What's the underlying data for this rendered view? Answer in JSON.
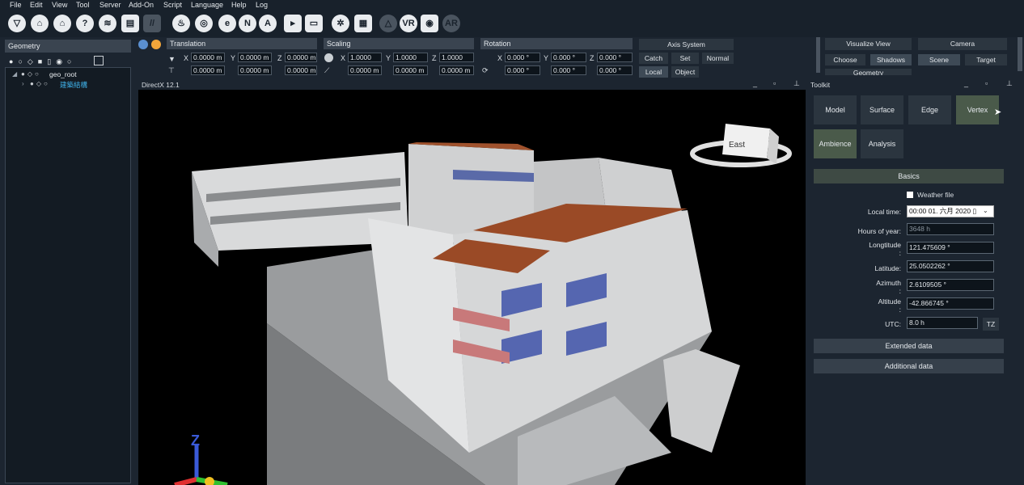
{
  "menu": [
    "File",
    "Edit",
    "View",
    "Tool",
    "Server",
    "Add-On",
    "Script",
    "Language",
    "Help",
    "Log"
  ],
  "transform": {
    "translation_title": "Translation",
    "scaling_title": "Scaling",
    "rotation_title": "Rotation",
    "axis_labels": [
      "X",
      "Y",
      "Z"
    ],
    "translation_row1": [
      "0.0000 m",
      "0.0000 m",
      "0.0000 m"
    ],
    "translation_row2": [
      "0.0000 m",
      "0.0000 m",
      "0.0000 m"
    ],
    "scaling_row1": [
      "1.0000",
      "1.0000",
      "1.0000"
    ],
    "scaling_row2": [
      "0.0000 m",
      "0.0000 m",
      "0.0000 m"
    ],
    "rotation_row1": [
      "0.000 °",
      "0.000 °",
      "0.000 °"
    ],
    "rotation_row2": [
      "0.000 °",
      "0.000 °",
      "0.000 °"
    ]
  },
  "axis_system": {
    "title": "Axis System",
    "buttons": [
      "Catch",
      "Set",
      "Normal",
      "Local",
      "Object"
    ]
  },
  "visualize": {
    "title": "Visualize View",
    "buttons": [
      "Choose",
      "Shadows"
    ],
    "partial": "Geometry"
  },
  "camera": {
    "title": "Camera",
    "buttons": [
      "Scene",
      "Target"
    ]
  },
  "geometry_panel": {
    "title": "Geometry",
    "tree": [
      {
        "label": "geo_root"
      },
      {
        "label": "建築結構"
      }
    ]
  },
  "viewport": {
    "title": "DirectX 12.1",
    "cube_label": "East"
  },
  "toolkit": {
    "title": "Toolkit",
    "tabs": [
      "Model",
      "Surface",
      "Edge",
      "Vertex",
      "Ambience",
      "Analysis"
    ],
    "basics": "Basics",
    "weather_file": "Weather file",
    "local_time_label": "Local time:",
    "local_time": "00:00 01. 六月 2020 ▯",
    "hours_label": "Hours of year:",
    "hours": "3648 h",
    "longitude_label": "Longtitude",
    "longitude": "121.475609 °",
    "latitude_label": "Latitude:",
    "latitude": "25.0502262 °",
    "azimuth_label": "Azimuth",
    "azimuth": "2.6109505 °",
    "altitude_label": "Altitude",
    "altitude": "-42.866745 °",
    "utc_label": "UTC:",
    "utc": "8.0 h",
    "tz": "TZ",
    "extended": "Extended data",
    "additional": "Additional data",
    "colon": ":"
  }
}
